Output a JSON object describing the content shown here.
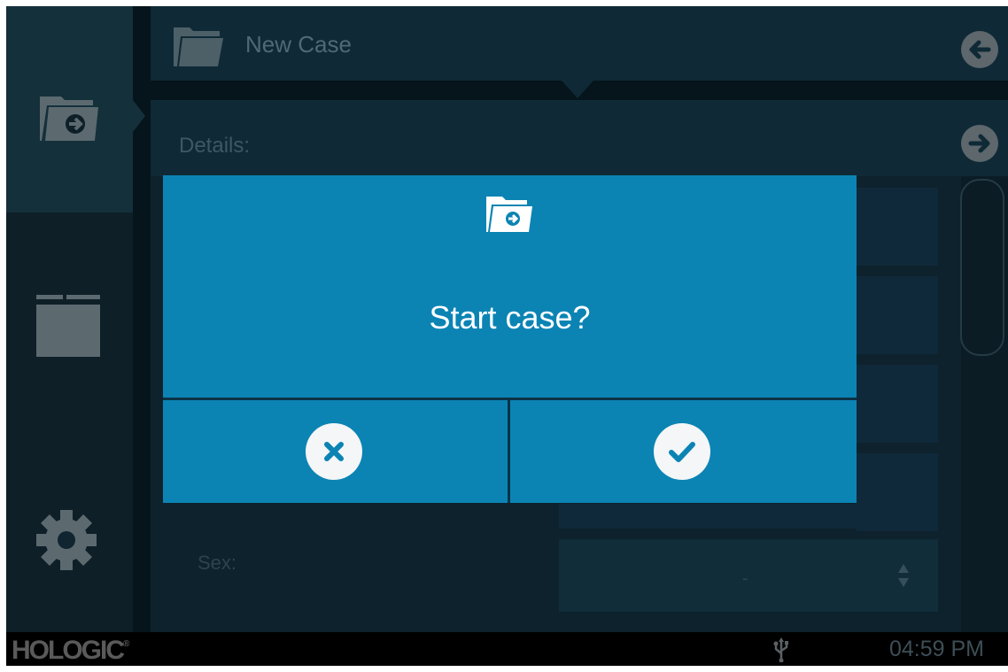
{
  "header": {
    "title": "New Case"
  },
  "details": {
    "label": "Details:"
  },
  "form": {
    "sex_label": "Sex:",
    "sex_value": "-"
  },
  "dialog": {
    "message": "Start case?"
  },
  "footer": {
    "brand": "HOLOGIC",
    "brand_mark": "®",
    "time": "04:59 PM"
  },
  "icons": {
    "rail": [
      "folder-arrow-icon",
      "folder-icon",
      "gear-icon"
    ],
    "header": [
      "open-folder-icon",
      "back-arrow-icon"
    ],
    "details": [
      "forward-arrow-icon"
    ],
    "dialog": [
      "folder-arrow-icon",
      "close-icon",
      "check-icon"
    ],
    "footer": [
      "usb-icon"
    ]
  },
  "colors": {
    "dialog_bg": "#0b84b4",
    "background": "#102530",
    "accent_gray": "#5d676c"
  }
}
